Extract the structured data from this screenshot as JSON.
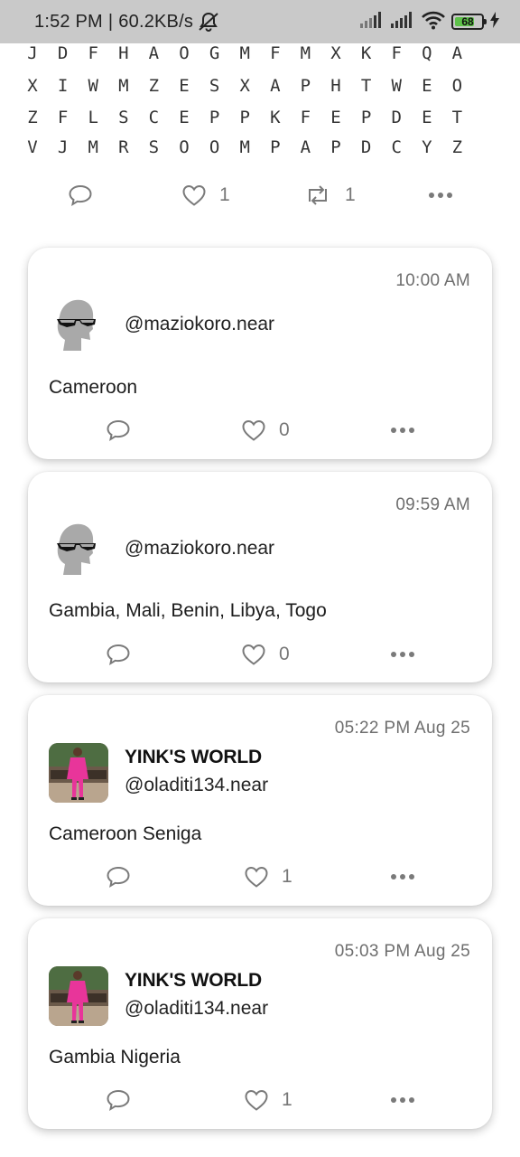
{
  "status_bar": {
    "time": "1:52 PM",
    "separator": "|",
    "speed": "60.2KB/s",
    "battery": "68",
    "icons": [
      "mute-icon",
      "signal-icon",
      "signal-icon",
      "wifi-icon",
      "battery-icon",
      "charging-icon"
    ]
  },
  "word_search": {
    "rows": [
      [
        "J",
        "D",
        "F",
        "H",
        "A",
        "O",
        "G",
        "M",
        "F",
        "M",
        "X",
        "K",
        "F",
        "Q",
        "A"
      ],
      [
        "X",
        "I",
        "W",
        "M",
        "Z",
        "E",
        "S",
        "X",
        "A",
        "P",
        "H",
        "T",
        "W",
        "E",
        "O"
      ],
      [
        "Z",
        "F",
        "L",
        "S",
        "C",
        "E",
        "P",
        "P",
        "K",
        "F",
        "E",
        "P",
        "D",
        "E",
        "T"
      ],
      [
        "V",
        "J",
        "M",
        "R",
        "S",
        "O",
        "O",
        "M",
        "P",
        "A",
        "P",
        "D",
        "C",
        "Y",
        "Z"
      ]
    ]
  },
  "top_post_actions": {
    "likes": "1",
    "reposts": "1",
    "icons": [
      "comment-icon",
      "heart-icon",
      "repost-icon",
      "more-icon"
    ]
  },
  "posts": [
    {
      "time": "10:00 AM",
      "display_name": "",
      "handle": "@maziokoro.near",
      "content": "Cameroon",
      "likes": "0",
      "avatar": "default-avatar-sunglasses"
    },
    {
      "time": "09:59 AM",
      "display_name": "",
      "handle": "@maziokoro.near",
      "content": "Gambia, Mali, Benin, Libya, Togo",
      "likes": "0",
      "avatar": "default-avatar-sunglasses"
    },
    {
      "time": "05:22 PM Aug 25",
      "display_name": "YINK'S WORLD",
      "handle": "@oladiti134.near",
      "content": "Cameroon Seniga",
      "likes": "1",
      "avatar": "photo-person-pink-outfit"
    },
    {
      "time": "05:03 PM Aug 25",
      "display_name": "YINK'S WORLD",
      "handle": "@oladiti134.near",
      "content": "Gambia Nigeria",
      "likes": "1",
      "avatar": "photo-person-pink-outfit"
    }
  ],
  "colors": {
    "status_bar_bg": "#c9c9c9",
    "icon_gray": "#7a7a7a",
    "text_dark": "#1c1c1c",
    "time_gray": "#6e6e6e",
    "battery_green": "#5ec14a",
    "avatar_pink": "#e8359a"
  }
}
